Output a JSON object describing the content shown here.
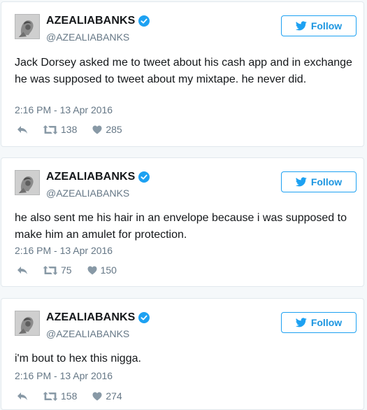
{
  "colors": {
    "follow_accent": "#1da1f2",
    "verified_badge": "#1da1f2",
    "muted_text": "#657786",
    "body_text": "#14171a"
  },
  "icons": [
    "avatar-image",
    "verified-icon",
    "twitter-bird-icon",
    "reply-icon",
    "retweet-icon",
    "heart-icon"
  ],
  "tweets": [
    {
      "display_name": "AZEALIABANKS",
      "handle": "@AZEALIABANKS",
      "follow_label": "Follow",
      "text": "Jack Dorsey asked me to tweet about his cash app and in exchange he was supposed to tweet about my mixtape. he never did.",
      "timestamp": "2:16 PM - 13 Apr 2016",
      "retweets": "138",
      "likes": "285"
    },
    {
      "display_name": "AZEALIABANKS",
      "handle": "@AZEALIABANKS",
      "follow_label": "Follow",
      "text": "he also sent me his hair in an envelope because i was supposed to make him an amulet for protection.",
      "timestamp": "2:16 PM - 13 Apr 2016",
      "retweets": "75",
      "likes": "150"
    },
    {
      "display_name": "AZEALIABANKS",
      "handle": "@AZEALIABANKS",
      "follow_label": "Follow",
      "text": "i'm bout to hex this nigga.",
      "timestamp": "2:16 PM - 13 Apr 2016",
      "retweets": "158",
      "likes": "274"
    }
  ]
}
